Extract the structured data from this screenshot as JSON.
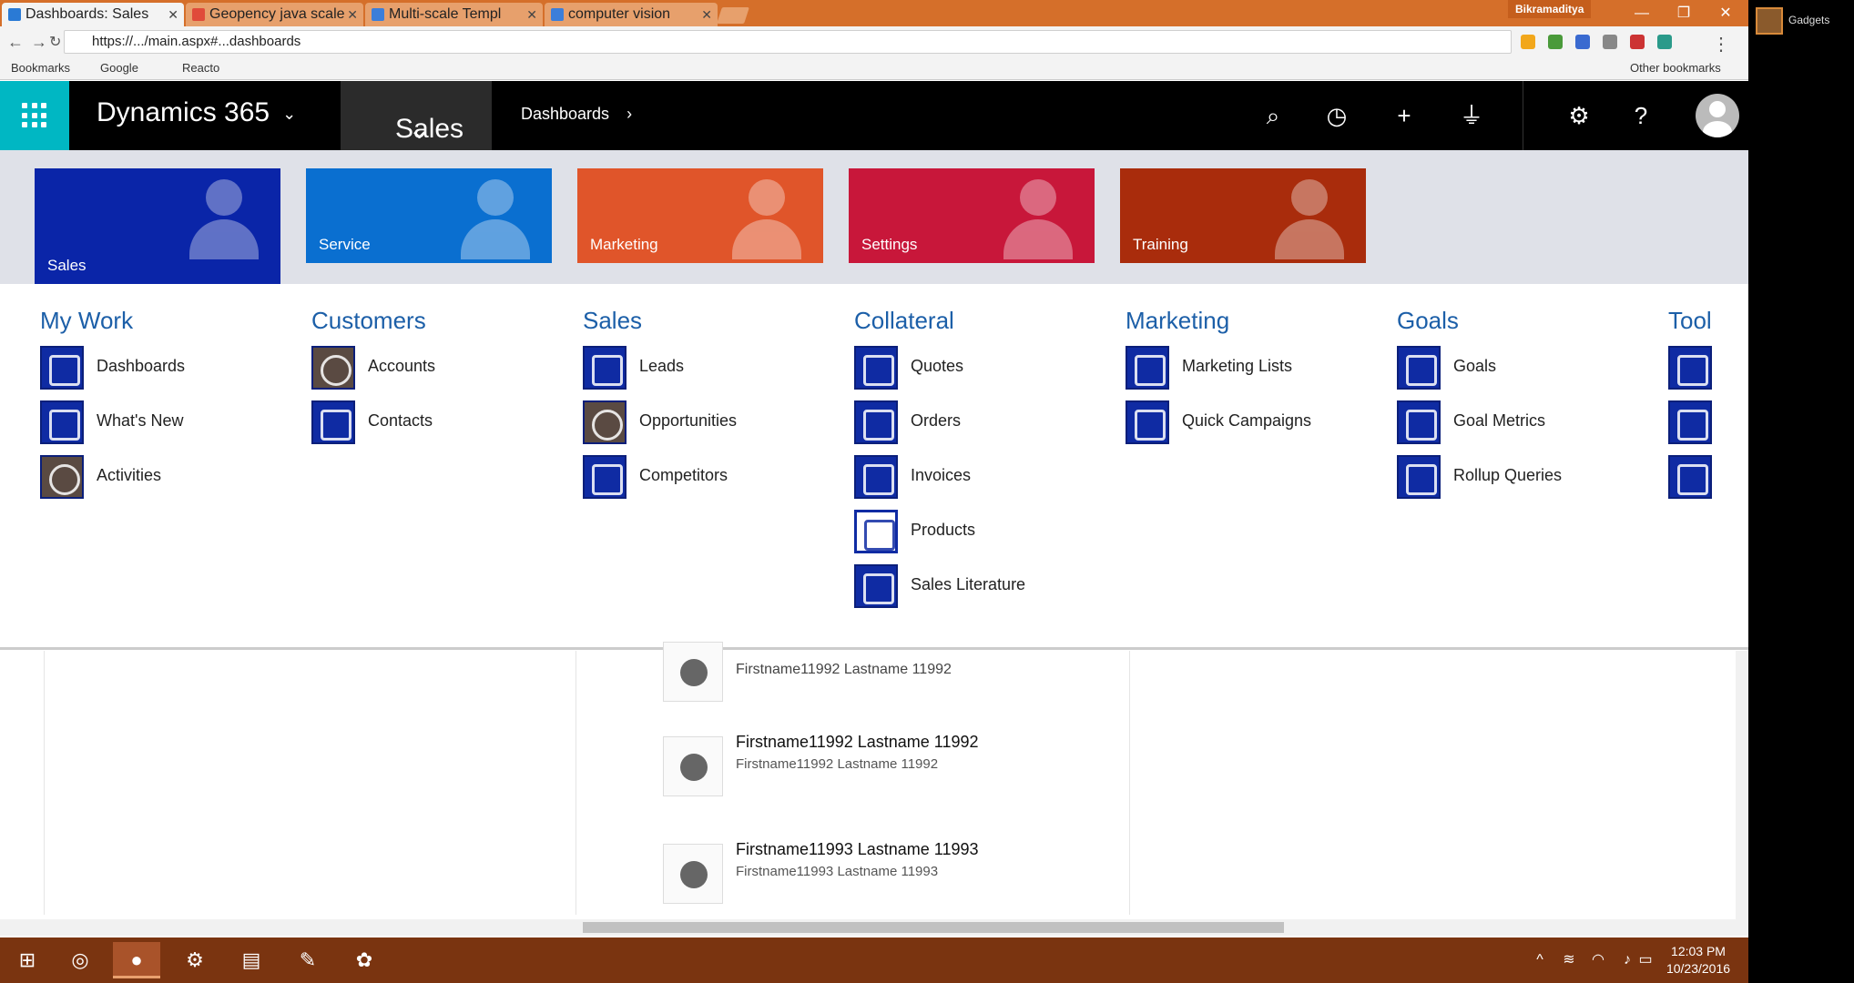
{
  "browser": {
    "tabs": [
      {
        "title": "Dashboards: Sales",
        "color": "#2a7ad5",
        "active": true
      },
      {
        "title": "Geopency java scale",
        "color": "#e04b3a",
        "active": false
      },
      {
        "title": "Multi-scale Templ",
        "color": "#3c7ed9",
        "active": false
      },
      {
        "title": "computer vision",
        "color": "#3c7ed9",
        "active": false
      }
    ],
    "profile_name": "Bikramaditya",
    "address": "https://.../main.aspx#...dashboards",
    "bookmarks": [
      "Bookmarks",
      "Google",
      "Reacto",
      "Other bookmarks"
    ],
    "window_controls": {
      "minimize": "—",
      "restore": "❐",
      "close": "✕"
    }
  },
  "navbar": {
    "brand": "Dynamics 365",
    "app": "Sales",
    "breadcrumb": "Dashboards",
    "icons": [
      "search-icon",
      "recent-icon",
      "new-record-icon",
      "advanced-find-icon",
      "settings-icon",
      "help-icon"
    ],
    "colors": {
      "waffle": "#00b7c3",
      "bar": "#000000"
    }
  },
  "areas": [
    {
      "label": "Sales",
      "color": "#0a25a8",
      "selected": true
    },
    {
      "label": "Service",
      "color": "#0a6fd0",
      "selected": false
    },
    {
      "label": "Marketing",
      "color": "#e0552a",
      "selected": false
    },
    {
      "label": "Settings",
      "color": "#c8173a",
      "selected": false
    },
    {
      "label": "Training",
      "color": "#a92c0c",
      "selected": false
    }
  ],
  "groups": [
    {
      "title": "My Work",
      "items": [
        "Dashboards",
        "What's New",
        "Activities"
      ]
    },
    {
      "title": "Customers",
      "items": [
        "Accounts",
        "Contacts"
      ]
    },
    {
      "title": "Sales",
      "items": [
        "Leads",
        "Opportunities",
        "Competitors"
      ]
    },
    {
      "title": "Collateral",
      "items": [
        "Quotes",
        "Orders",
        "Invoices",
        "Products",
        "Sales Literature"
      ]
    },
    {
      "title": "Marketing",
      "items": [
        "Marketing Lists",
        "Quick Campaigns"
      ]
    },
    {
      "title": "Goals",
      "items": [
        "Goals",
        "Goal Metrics",
        "Rollup Queries"
      ]
    },
    {
      "title": "Tool",
      "items": [
        "",
        "",
        ""
      ]
    }
  ],
  "records": [
    {
      "name": "Firstname11992 Lastname 11992",
      "sub": "Firstname11992 Lastname 11992"
    },
    {
      "name": "Firstname11992 Lastname 11992",
      "sub": "Firstname11992 Lastname 11992"
    },
    {
      "name": "Firstname11993 Lastname 11993",
      "sub": "Firstname11993 Lastname 11993"
    }
  ],
  "taskbar": {
    "time": "12:03 PM",
    "date": "10/23/2016"
  },
  "side_panel": {
    "label": "Gadgets"
  }
}
